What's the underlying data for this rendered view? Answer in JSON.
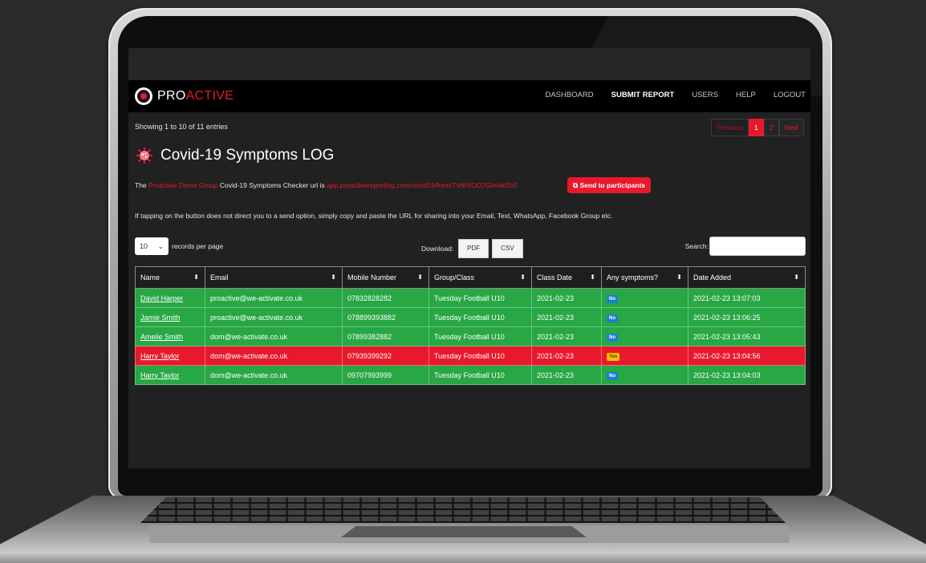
{
  "nav": {
    "logo_pro": "PRO",
    "logo_active": "ACTIVE",
    "links": [
      "DASHBOARD",
      "SUBMIT REPORT",
      "USERS",
      "HELP",
      "LOGOUT"
    ]
  },
  "summary": {
    "showing": "Showing 1 to 10 of 11 entries"
  },
  "pagination": {
    "previous": "Previous",
    "pages": [
      "1",
      "2"
    ],
    "next": "Next"
  },
  "page": {
    "title": "Covid-19 Symptoms LOG",
    "info_prefix": "The",
    "group_name": "Proactive Demo Group",
    "info_middle": "Covid-19 Symptoms Checker url is",
    "url": "app.proactivereporting.com/covid19/form/TxNtVOO7GlmekEh5",
    "send_button": "Send to participants",
    "info2": "If tapping on the button does not direct you to a send option, simply copy and paste the URL for sharing into your Email, Text, WhatsApp, Facebook Group etc."
  },
  "controls": {
    "page_length": "10",
    "records_label": "records per page",
    "download_label": "Download:",
    "pdf": "PDF",
    "csv": "CSV",
    "search_label": "Search:"
  },
  "table": {
    "headers": [
      "Name",
      "Email",
      "Mobile Number",
      "Group/Class",
      "Class Date",
      "Any symptoms?",
      "Date Added"
    ],
    "rows": [
      {
        "name": "David Harper",
        "email": "proactive@we-activate.co.uk",
        "mobile": "07832828282",
        "group": "Tuesday Football U10",
        "class_date": "2021-02-23",
        "symptoms": "No",
        "date_added": "2021-02-23 13:07:03",
        "status": "green"
      },
      {
        "name": "Jamie Smith",
        "email": "proactive@we-activate.co.uk",
        "mobile": "078899393882",
        "group": "Tuesday Football U10",
        "class_date": "2021-02-23",
        "symptoms": "No",
        "date_added": "2021-02-23 13:06:25",
        "status": "green"
      },
      {
        "name": "Amelie Smith",
        "email": "dom@we-activate.co.uk",
        "mobile": "07899382882",
        "group": "Tuesday Football U10",
        "class_date": "2021-02-23",
        "symptoms": "No",
        "date_added": "2021-02-23 13:05:43",
        "status": "green"
      },
      {
        "name": "Harry Taylor",
        "email": "dom@we-activate.co.uk",
        "mobile": "07939399292",
        "group": "Tuesday Football U10",
        "class_date": "2021-02-23",
        "symptoms": "Yes",
        "date_added": "2021-02-23 13:04:56",
        "status": "red"
      },
      {
        "name": "Harry Taylor",
        "email": "dom@we-activate.co.uk",
        "mobile": "09707993999",
        "group": "Tuesday Football U10",
        "class_date": "2021-02-23",
        "symptoms": "No",
        "date_added": "2021-02-23 13:04:03",
        "status": "green"
      }
    ]
  },
  "colors": {
    "brand_red": "#e8192c",
    "row_green": "#28a745",
    "badge_no": "#1b7fd1",
    "badge_yes": "#f5c000"
  },
  "icons": {
    "logo": "proactive-eye-icon",
    "title": "virus-icon",
    "send": "share-icon",
    "sort": "sort-icon",
    "select": "chevron-down-icon"
  }
}
